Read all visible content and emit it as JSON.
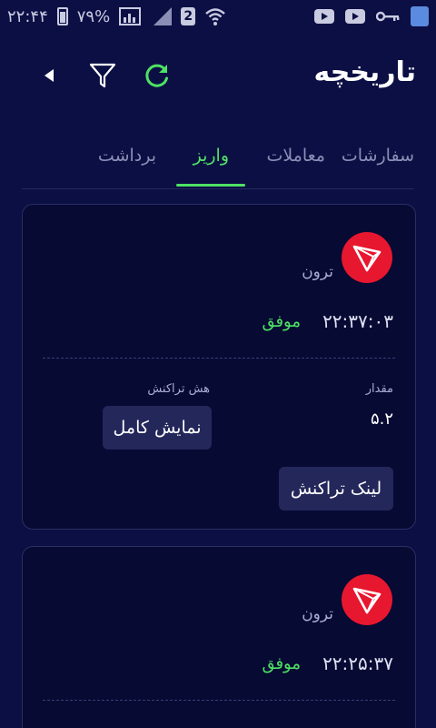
{
  "status_bar": {
    "time": "۲۲:۴۴",
    "battery": "۷۹%",
    "sim": "2"
  },
  "header": {
    "title": "تاریخچه"
  },
  "tabs": [
    {
      "label": "سفارشات",
      "active": false
    },
    {
      "label": "معاملات",
      "active": false
    },
    {
      "label": "واریز",
      "active": true
    },
    {
      "label": "برداشت",
      "active": false
    }
  ],
  "transactions": [
    {
      "coin": "ترون",
      "time": "۲۲:۳۷:۰۳",
      "status": "موفق",
      "amount_label": "مقدار",
      "amount": "۵.۲",
      "hash_label": "هش تراکنش",
      "full_hash_button": "نمایش کامل",
      "tx_link_button": "لینک تراکنش"
    },
    {
      "coin": "ترون",
      "time": "۲۲:۲۵:۳۷",
      "status": "موفق"
    }
  ],
  "colors": {
    "background": "#0b0f44",
    "accent_green": "#4ee264",
    "tron_red": "#e6172f",
    "button_bg": "#232759"
  }
}
